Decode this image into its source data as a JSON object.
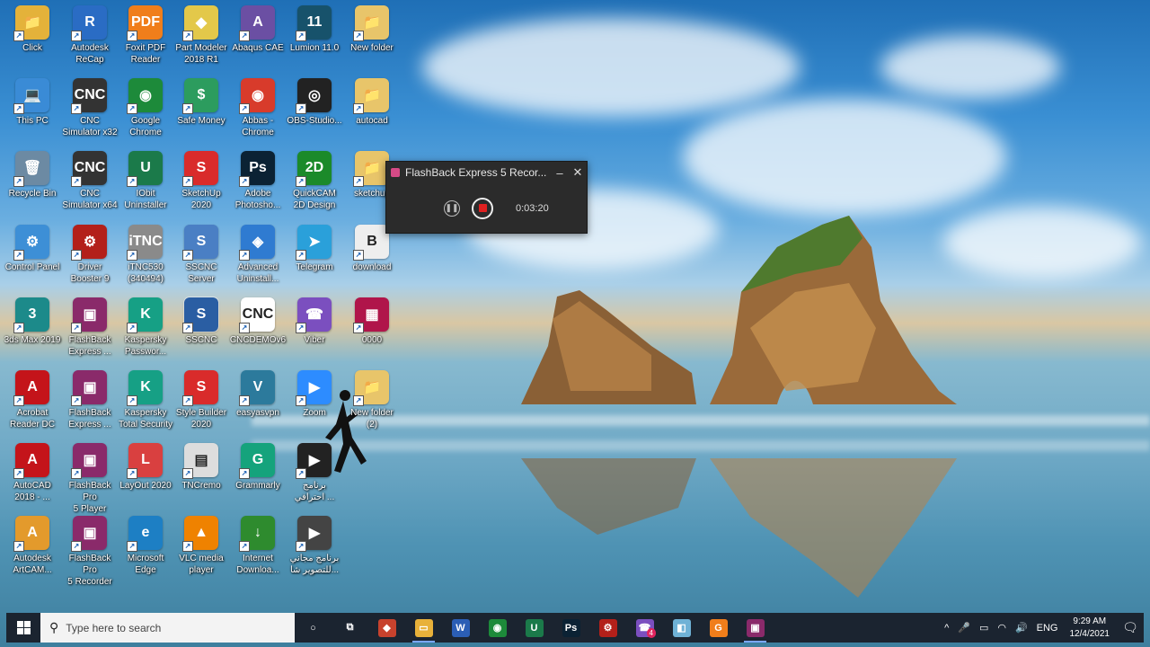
{
  "desktop": {
    "icons": [
      {
        "label": "Click",
        "color": "#e4b23a",
        "glyph": "📁"
      },
      {
        "label": "Autodesk\nReCap",
        "color": "#2a6cc4",
        "glyph": "R"
      },
      {
        "label": "Foxit PDF\nReader",
        "color": "#f07e1b",
        "glyph": "PDF"
      },
      {
        "label": "Part Modeler\n2018 R1",
        "color": "#e3c84a",
        "glyph": "◆"
      },
      {
        "label": "Abaqus CAE",
        "color": "#6b4fa3",
        "glyph": "A"
      },
      {
        "label": "Lumion 11.0",
        "color": "#17526b",
        "glyph": "11"
      },
      {
        "label": "New folder",
        "color": "#e8c56a",
        "glyph": "📁"
      },
      {
        "label": "This PC",
        "color": "#3a8bd6",
        "glyph": "💻"
      },
      {
        "label": "CNC\nSimulator x32",
        "color": "#333333",
        "glyph": "CNC"
      },
      {
        "label": "Google\nChrome",
        "color": "#1d8a3a",
        "glyph": "◉"
      },
      {
        "label": "Safe Money",
        "color": "#2c9c5e",
        "glyph": "$"
      },
      {
        "label": "Abbas -\nChrome",
        "color": "#d83b2b",
        "glyph": "◉"
      },
      {
        "label": "OBS-Studio...",
        "color": "#222222",
        "glyph": "◎"
      },
      {
        "label": "autocad",
        "color": "#e8c56a",
        "glyph": "📁"
      },
      {
        "label": "Recycle Bin",
        "color": "#6c8aa3",
        "glyph": "🗑"
      },
      {
        "label": "CNC\nSimulator x64",
        "color": "#333333",
        "glyph": "CNC"
      },
      {
        "label": "IObit\nUninstaller",
        "color": "#1b7a4a",
        "glyph": "U"
      },
      {
        "label": "SketchUp\n2020",
        "color": "#d92b2b",
        "glyph": "S"
      },
      {
        "label": "Adobe\nPhotosho...",
        "color": "#0b2234",
        "glyph": "Ps"
      },
      {
        "label": "QuickCAM\n2D Design",
        "color": "#1b8a2a",
        "glyph": "2D"
      },
      {
        "label": "sketchup",
        "color": "#e8c56a",
        "glyph": "📁"
      },
      {
        "label": "Control Panel",
        "color": "#3d8fd6",
        "glyph": "⚙"
      },
      {
        "label": "Driver\nBooster 9",
        "color": "#b3201a",
        "glyph": "⚙"
      },
      {
        "label": "iTNC530\n(340494)",
        "color": "#8a8a8a",
        "glyph": "iTNC"
      },
      {
        "label": "SSCNC Server",
        "color": "#4a7fc4",
        "glyph": "S"
      },
      {
        "label": "Advanced\nUninstall...",
        "color": "#2f7bd1",
        "glyph": "◈"
      },
      {
        "label": "Telegram",
        "color": "#2aa0da",
        "glyph": "➤"
      },
      {
        "label": "download",
        "color": "#eeeeee",
        "glyph": "B"
      },
      {
        "label": "3ds Max 2019",
        "color": "#1c8a8a",
        "glyph": "3"
      },
      {
        "label": "FlashBack\nExpress ...",
        "color": "#8a2a6a",
        "glyph": "▣"
      },
      {
        "label": "Kaspersky\nPasswor...",
        "color": "#16a085",
        "glyph": "K"
      },
      {
        "label": "SSCNC",
        "color": "#2a5ea3",
        "glyph": "S"
      },
      {
        "label": "CNCDEMOv6",
        "color": "#ffffff",
        "glyph": "CNC"
      },
      {
        "label": "Viber",
        "color": "#7b4fbf",
        "glyph": "☎"
      },
      {
        "label": "0000",
        "color": "#b0154a",
        "glyph": "▦"
      },
      {
        "label": "Acrobat\nReader DC",
        "color": "#c4141a",
        "glyph": "A"
      },
      {
        "label": "FlashBack\nExpress ...",
        "color": "#8a2a6a",
        "glyph": "▣"
      },
      {
        "label": "Kaspersky\nTotal Security",
        "color": "#16a085",
        "glyph": "K"
      },
      {
        "label": "Style Builder\n2020",
        "color": "#d92b2b",
        "glyph": "S"
      },
      {
        "label": "easyasvpn",
        "color": "#2c7a9c",
        "glyph": "V"
      },
      {
        "label": "Zoom",
        "color": "#2d8cff",
        "glyph": "▶"
      },
      {
        "label": "New folder\n(2)",
        "color": "#e8c56a",
        "glyph": "📁"
      },
      {
        "label": "AutoCAD\n2018 - ...",
        "color": "#c4141a",
        "glyph": "A"
      },
      {
        "label": "FlashBack Pro\n5 Player",
        "color": "#8a2a6a",
        "glyph": "▣"
      },
      {
        "label": "LayOut 2020",
        "color": "#d94040",
        "glyph": "L"
      },
      {
        "label": "TNCremo",
        "color": "#dddddd",
        "glyph": "▤"
      },
      {
        "label": "Grammarly",
        "color": "#15a37c",
        "glyph": "G"
      },
      {
        "label": "برنامج\nاحترافي ...",
        "color": "#222222",
        "glyph": "▶"
      },
      {
        "label": "Autodesk\nArtCAM...",
        "color": "#e39a2c",
        "glyph": "A"
      },
      {
        "label": "FlashBack Pro\n5 Recorder",
        "color": "#8a2a6a",
        "glyph": "▣"
      },
      {
        "label": "Microsoft\nEdge",
        "color": "#1d7fc4",
        "glyph": "e"
      },
      {
        "label": "VLC media\nplayer",
        "color": "#ef8200",
        "glyph": "▲"
      },
      {
        "label": "Internet\nDownloa...",
        "color": "#2e8b2e",
        "glyph": "↓"
      },
      {
        "label": "برنامج مجاني\nللتصوير شا...",
        "color": "#444444",
        "glyph": "▶"
      }
    ]
  },
  "recorder": {
    "title": "FlashBack Express 5 Recor...",
    "minimize": "–",
    "close": "✕",
    "time": "0:03:20"
  },
  "taskbar": {
    "search_placeholder": "Type here to search",
    "apps": [
      {
        "icon": "cortana-icon",
        "glyph": "○",
        "color": "transparent"
      },
      {
        "icon": "task-view-icon",
        "glyph": "⧉",
        "color": "transparent"
      },
      {
        "icon": "app-red-icon",
        "glyph": "◆",
        "color": "#c7422d"
      },
      {
        "icon": "file-explorer-icon",
        "glyph": "▭",
        "color": "#e8b13a",
        "active": true
      },
      {
        "icon": "word-icon",
        "glyph": "W",
        "color": "#2b5eb5"
      },
      {
        "icon": "chrome-icon",
        "glyph": "◉",
        "color": "#1d8a3a"
      },
      {
        "icon": "iobit-icon",
        "glyph": "U",
        "color": "#1b7a4a"
      },
      {
        "icon": "photoshop-icon",
        "glyph": "Ps",
        "color": "#0b2234"
      },
      {
        "icon": "driver-booster-icon",
        "glyph": "⚙",
        "color": "#b3201a"
      },
      {
        "icon": "viber-icon",
        "glyph": "☎",
        "color": "#7b4fbf",
        "badge": "4"
      },
      {
        "icon": "app-cube-icon",
        "glyph": "◧",
        "color": "#6fb2d6"
      },
      {
        "icon": "foxit-icon",
        "glyph": "G",
        "color": "#f07e1b"
      },
      {
        "icon": "flashback-icon",
        "glyph": "▣",
        "color": "#8a2a6a",
        "active": true
      }
    ],
    "tray": {
      "chevron": "^",
      "mic": "🎤",
      "battery": "▭",
      "network": "◠",
      "volume": "🔊",
      "language": "ENG",
      "time": "9:29 AM",
      "date": "12/4/2021",
      "notifications": "🗨"
    }
  }
}
